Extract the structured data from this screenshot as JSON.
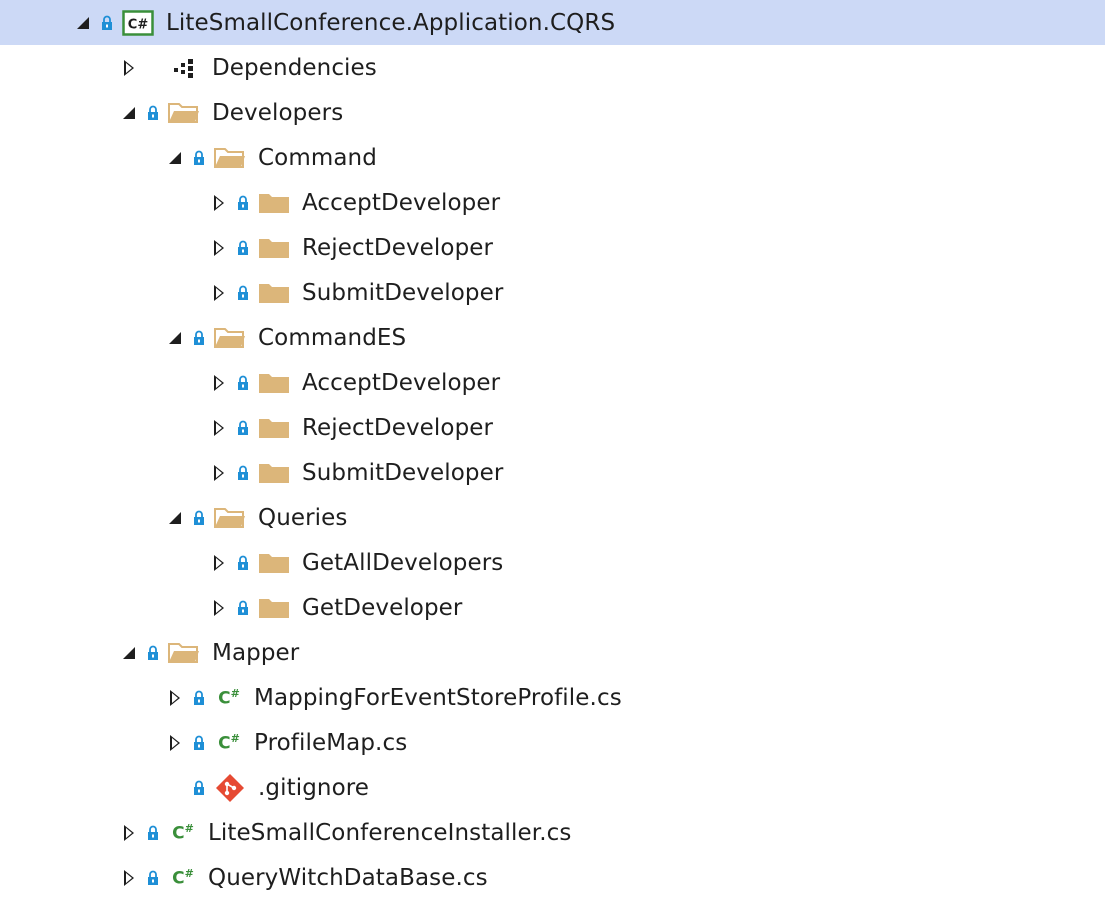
{
  "colors": {
    "selection": "#ccd9f6",
    "folder": "#dcb67a",
    "lock": "#1e8fd6",
    "csharp": "#3a8f3a",
    "git": "#e64a33"
  },
  "tree": {
    "items": [
      {
        "label": "LiteSmallConference.Application.CQRS",
        "icon": "csharp-project-icon",
        "expander": "expanded",
        "locked": true,
        "selected": true
      },
      {
        "label": "Dependencies",
        "icon": "dependencies-icon",
        "expander": "collapsed",
        "locked": false
      },
      {
        "label": "Developers",
        "icon": "folder-open-icon",
        "expander": "expanded",
        "locked": true
      },
      {
        "label": "Command",
        "icon": "folder-open-icon",
        "expander": "expanded",
        "locked": true
      },
      {
        "label": "AcceptDeveloper",
        "icon": "folder-icon",
        "expander": "collapsed",
        "locked": true
      },
      {
        "label": "RejectDeveloper",
        "icon": "folder-icon",
        "expander": "collapsed",
        "locked": true
      },
      {
        "label": "SubmitDeveloper",
        "icon": "folder-icon",
        "expander": "collapsed",
        "locked": true
      },
      {
        "label": "CommandES",
        "icon": "folder-open-icon",
        "expander": "expanded",
        "locked": true
      },
      {
        "label": "AcceptDeveloper",
        "icon": "folder-icon",
        "expander": "collapsed",
        "locked": true
      },
      {
        "label": "RejectDeveloper",
        "icon": "folder-icon",
        "expander": "collapsed",
        "locked": true
      },
      {
        "label": "SubmitDeveloper",
        "icon": "folder-icon",
        "expander": "collapsed",
        "locked": true
      },
      {
        "label": "Queries",
        "icon": "folder-open-icon",
        "expander": "expanded",
        "locked": true
      },
      {
        "label": "GetAllDevelopers",
        "icon": "folder-icon",
        "expander": "collapsed",
        "locked": true
      },
      {
        "label": "GetDeveloper",
        "icon": "folder-icon",
        "expander": "collapsed",
        "locked": true
      },
      {
        "label": "Mapper",
        "icon": "folder-open-icon",
        "expander": "expanded",
        "locked": true
      },
      {
        "label": "MappingForEventStoreProfile.cs",
        "icon": "csharp-file-icon",
        "expander": "collapsed",
        "locked": true
      },
      {
        "label": "ProfileMap.cs",
        "icon": "csharp-file-icon",
        "expander": "collapsed",
        "locked": true
      },
      {
        "label": ".gitignore",
        "icon": "git-icon",
        "expander": "none",
        "locked": true
      },
      {
        "label": "LiteSmallConferenceInstaller.cs",
        "icon": "csharp-file-icon",
        "expander": "collapsed",
        "locked": true
      },
      {
        "label": "QueryWitchDataBase.cs",
        "icon": "csharp-file-icon",
        "expander": "collapsed",
        "locked": true
      }
    ]
  }
}
